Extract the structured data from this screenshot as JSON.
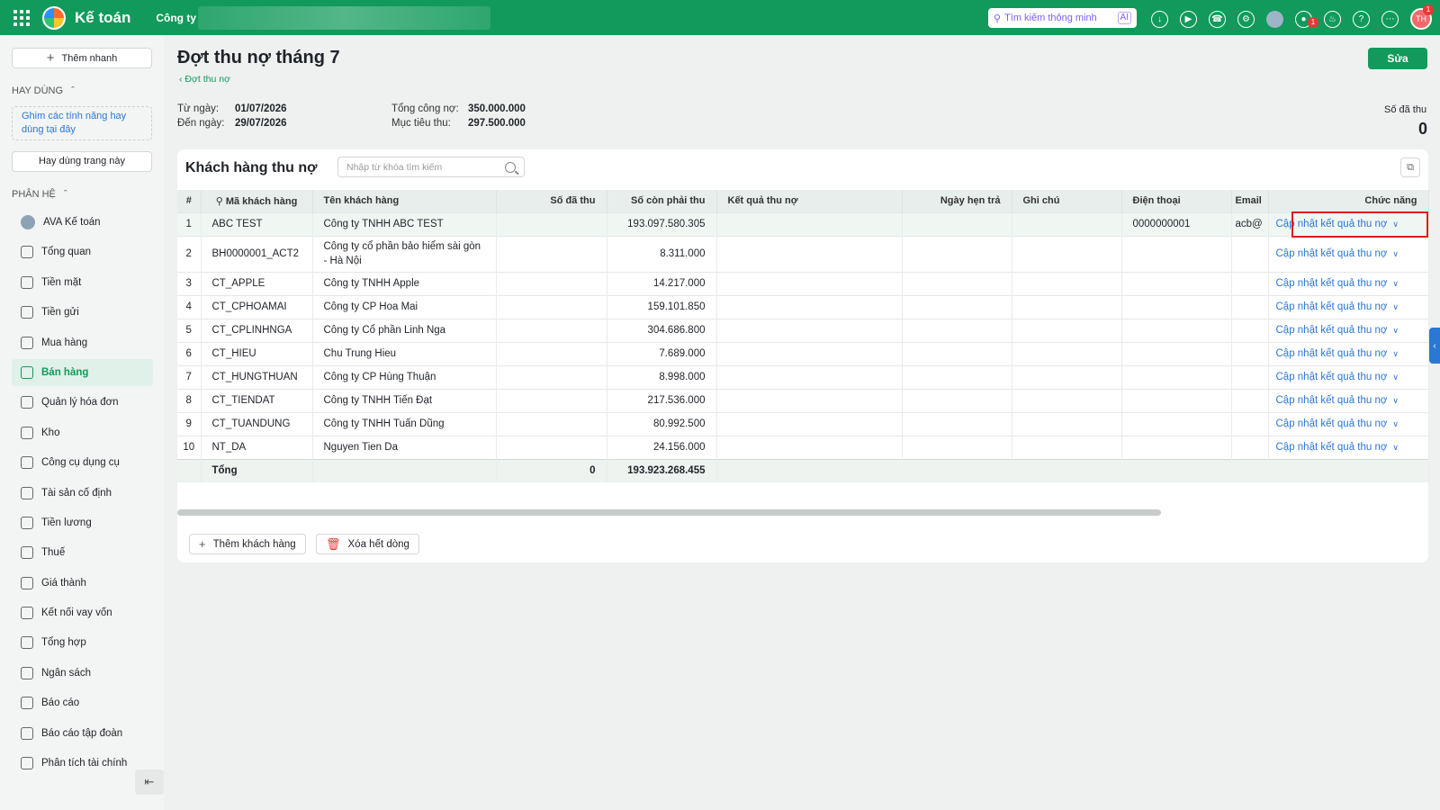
{
  "topbar": {
    "app_name": "Kế toán",
    "company_label": "Công ty",
    "search_placeholder": "Tìm kiếm thông minh",
    "search_ai_badge": "AI",
    "chat_badge": "1",
    "user_initials": "TH",
    "user_badge": "1"
  },
  "sidebar": {
    "quick_add_label": "Thêm nhanh",
    "frequent_title": "HAY DÙNG",
    "pin_hint": "Ghim các tính năng hay dùng tại đây",
    "frequent_button": "Hay dùng trang này",
    "modules_title": "PHÂN HỆ",
    "items": [
      {
        "label": "AVA Kế toán",
        "icon": "ava-avatar-icon"
      },
      {
        "label": "Tổng quan",
        "icon": "dashboard-icon"
      },
      {
        "label": "Tiền mặt",
        "icon": "cash-icon"
      },
      {
        "label": "Tiền gửi",
        "icon": "bank-icon"
      },
      {
        "label": "Mua hàng",
        "icon": "shopping-bag-icon"
      },
      {
        "label": "Bán hàng",
        "icon": "cart-icon",
        "active": true
      },
      {
        "label": "Quản lý hóa đơn",
        "icon": "invoice-icon"
      },
      {
        "label": "Kho",
        "icon": "warehouse-icon"
      },
      {
        "label": "Công cụ dụng cụ",
        "icon": "tools-icon"
      },
      {
        "label": "Tài sản cố định",
        "icon": "vehicle-icon"
      },
      {
        "label": "Tiền lương",
        "icon": "salary-icon"
      },
      {
        "label": "Thuế",
        "icon": "tax-icon"
      },
      {
        "label": "Giá thành",
        "icon": "price-tag-icon"
      },
      {
        "label": "Kết nối vay vốn",
        "icon": "loan-icon"
      },
      {
        "label": "Tổng hợp",
        "icon": "summary-icon"
      },
      {
        "label": "Ngân sách",
        "icon": "budget-icon"
      },
      {
        "label": "Báo cáo",
        "icon": "report-icon"
      },
      {
        "label": "Báo cáo tập đoàn",
        "icon": "group-report-icon"
      },
      {
        "label": "Phân tích tài chính",
        "icon": "analytics-icon"
      }
    ]
  },
  "header": {
    "title": "Đợt thu nợ tháng 7",
    "back_label": "Đợt thu nợ",
    "edit_button": "Sửa",
    "from_label": "Từ ngày:",
    "from_value": "01/07/2026",
    "to_label": "Đến ngày:",
    "to_value": "29/07/2026",
    "total_debt_label": "Tổng công nợ:",
    "total_debt_value": "350.000.000",
    "target_label": "Mục tiêu thu:",
    "target_value": "297.500.000",
    "collected_label": "Số đã thu",
    "collected_value": "0"
  },
  "customers": {
    "title": "Khách hàng thu nợ",
    "search_placeholder": "Nhập từ khóa tìm kiếm",
    "columns": [
      "#",
      "Mã khách hàng",
      "Tên khách hàng",
      "Số đã thu",
      "Số còn phải thu",
      "Kết quả thu nợ",
      "Ngày hẹn trả",
      "Ghi chú",
      "Điện thoại",
      "Email",
      "Chức năng"
    ],
    "action_label": "Cập nhật kết quả thu nợ",
    "rows": [
      {
        "no": "1",
        "code": "ABC TEST",
        "name": "Công ty TNHH ABC TEST",
        "paid": "",
        "remaining": "193.097.580.305",
        "result": "",
        "date": "",
        "note": "",
        "phone": "0000000001",
        "email": "acb@"
      },
      {
        "no": "2",
        "code": "BH0000001_ACT2",
        "name": "Công ty cổ phần bảo hiểm sài gòn - Hà Nội",
        "paid": "",
        "remaining": "8.311.000",
        "result": "",
        "date": "",
        "note": "",
        "phone": "",
        "email": ""
      },
      {
        "no": "3",
        "code": "CT_APPLE",
        "name": "Công ty TNHH Apple",
        "paid": "",
        "remaining": "14.217.000",
        "result": "",
        "date": "",
        "note": "",
        "phone": "",
        "email": ""
      },
      {
        "no": "4",
        "code": "CT_CPHOAMAI",
        "name": "Công ty CP Hoa Mai",
        "paid": "",
        "remaining": "159.101.850",
        "result": "",
        "date": "",
        "note": "",
        "phone": "",
        "email": ""
      },
      {
        "no": "5",
        "code": "CT_CPLINHNGA",
        "name": "Công ty Cổ phần Linh Nga",
        "paid": "",
        "remaining": "304.686.800",
        "result": "",
        "date": "",
        "note": "",
        "phone": "",
        "email": ""
      },
      {
        "no": "6",
        "code": "CT_HIEU",
        "name": "Chu Trung Hieu",
        "paid": "",
        "remaining": "7.689.000",
        "result": "",
        "date": "",
        "note": "",
        "phone": "",
        "email": ""
      },
      {
        "no": "7",
        "code": "CT_HUNGTHUAN",
        "name": "Công ty CP Hùng Thuận",
        "paid": "",
        "remaining": "8.998.000",
        "result": "",
        "date": "",
        "note": "",
        "phone": "",
        "email": ""
      },
      {
        "no": "8",
        "code": "CT_TIENDAT",
        "name": "Công ty TNHH Tiến Đạt",
        "paid": "",
        "remaining": "217.536.000",
        "result": "",
        "date": "",
        "note": "",
        "phone": "",
        "email": ""
      },
      {
        "no": "9",
        "code": "CT_TUANDUNG",
        "name": "Công ty TNHH Tuấn Dũng",
        "paid": "",
        "remaining": "80.992.500",
        "result": "",
        "date": "",
        "note": "",
        "phone": "",
        "email": ""
      },
      {
        "no": "10",
        "code": "NT_DA",
        "name": "Nguyen Tien Da",
        "paid": "",
        "remaining": "24.156.000",
        "result": "",
        "date": "",
        "note": "",
        "phone": "",
        "email": ""
      }
    ],
    "total_label": "Tổng",
    "total_paid": "0",
    "total_remaining": "193.923.268.455",
    "add_button": "Thêm khách hàng",
    "clear_button": "Xóa hết dòng"
  },
  "colors": {
    "brand": "#119a5b",
    "link": "#2a77d4",
    "highlight": "#e01b1b"
  }
}
